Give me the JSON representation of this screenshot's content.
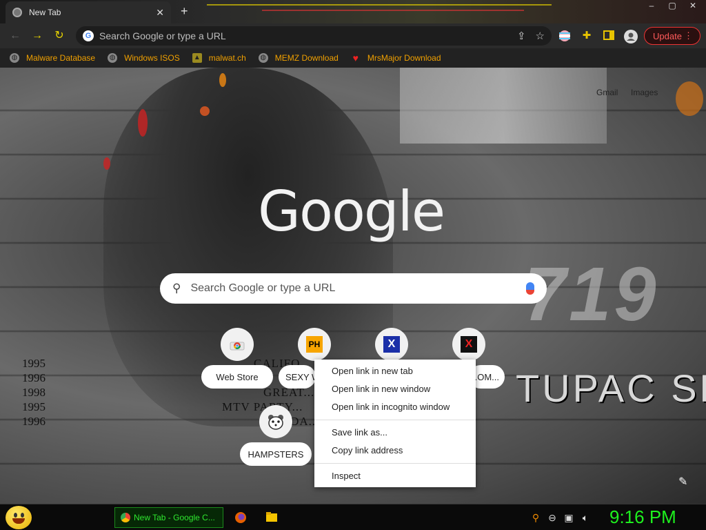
{
  "tab": {
    "title": "New Tab",
    "close": "✕"
  },
  "new_tab": "+",
  "window_controls": {
    "minimize": "–",
    "maximize": "▢",
    "close": "✕"
  },
  "toolbar": {
    "back": "←",
    "forward": "→",
    "reload": "↻",
    "omnibox_placeholder": "Search Google or type a URL",
    "update_label": "Update",
    "update_menu": "⋮"
  },
  "bookmarks": [
    {
      "label": "Malware Database",
      "icon": "globe-icon"
    },
    {
      "label": "Windows ISOS",
      "icon": "globe-icon"
    },
    {
      "label": "malwat.ch",
      "icon": "malwat-icon"
    },
    {
      "label": "MEMZ Download",
      "icon": "globe-icon"
    },
    {
      "label": "MrsMajor Download",
      "icon": "heart-icon"
    }
  ],
  "ntp": {
    "header_links": {
      "gmail": "Gmail",
      "images": "Images"
    },
    "logo": "Google",
    "search_placeholder": "Search Google or type a URL",
    "shortcuts": [
      {
        "label": "Web Store",
        "icon": "chrome-webstore-icon"
      },
      {
        "label": "SEXY W...",
        "icon_text": "PH"
      },
      {
        "label": "",
        "icon_text": "X"
      },
      {
        "label": "...OM...",
        "icon_text": "X"
      },
      {
        "label": "HAMPSTERS",
        "icon": "hamster-icon"
      }
    ],
    "wallpaper_text": {
      "years": [
        "1995",
        "1996",
        "1998",
        "1995",
        "1996"
      ],
      "songs": [
        "CALIFO...",
        "...",
        "GREAT...",
        "MTV PARTY...",
        "T... DA..."
      ],
      "big_number": "719",
      "name": "TUPAC SH"
    }
  },
  "context_menu": {
    "group1": [
      "Open link in new tab",
      "Open link in new window",
      "Open link in incognito window"
    ],
    "group2": [
      "Save link as...",
      "Copy link address"
    ],
    "group3": [
      "Inspect"
    ]
  },
  "taskbar": {
    "task_label": "New Tab - Google C...",
    "clock": "9:16 PM"
  },
  "colors": {
    "update_accent": "#ff5a5a",
    "bookmark_text": "#f0a000",
    "clock": "#1ef01e",
    "task_border": "#1c8a1c"
  }
}
